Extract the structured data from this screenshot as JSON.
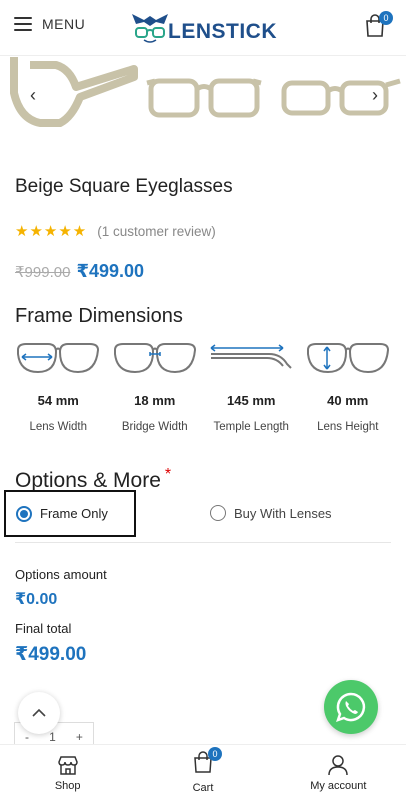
{
  "header": {
    "menu_label": "MENU",
    "logo_text": "LENSTICK",
    "cart_count": "0",
    "brand_color": "#1f4f8b"
  },
  "product": {
    "title": "Beige Square Eyeglasses",
    "stars": "★★★★★",
    "review_text": "(1 customer review)",
    "old_price": "₹999.00",
    "new_price": "₹499.00"
  },
  "frame_dimensions": {
    "title": "Frame Dimensions",
    "items": [
      {
        "value": "54 mm",
        "label": "Lens Width",
        "icon": "lens-width-icon"
      },
      {
        "value": "18 mm",
        "label": "Bridge Width",
        "icon": "bridge-width-icon"
      },
      {
        "value": "145 mm",
        "label": "Temple Length",
        "icon": "temple-length-icon"
      },
      {
        "value": "40 mm",
        "label": "Lens Height",
        "icon": "lens-height-icon"
      }
    ]
  },
  "options": {
    "title": "Options & More",
    "required_mark": "*",
    "frame_only": "Frame Only",
    "buy_with_lenses": "Buy With Lenses",
    "selected": "Frame Only"
  },
  "totals": {
    "options_label": "Options amount",
    "options_value": "₹0.00",
    "final_label": "Final total",
    "final_value": "₹499.00"
  },
  "quantity": {
    "minus": "-",
    "value": "1",
    "plus": "+"
  },
  "bottom_nav": {
    "shop": "Shop",
    "cart": "Cart",
    "cart_count": "0",
    "account": "My account"
  },
  "colors": {
    "accent": "#1e73be",
    "star": "#f5b301",
    "whatsapp": "#4cc96a"
  }
}
